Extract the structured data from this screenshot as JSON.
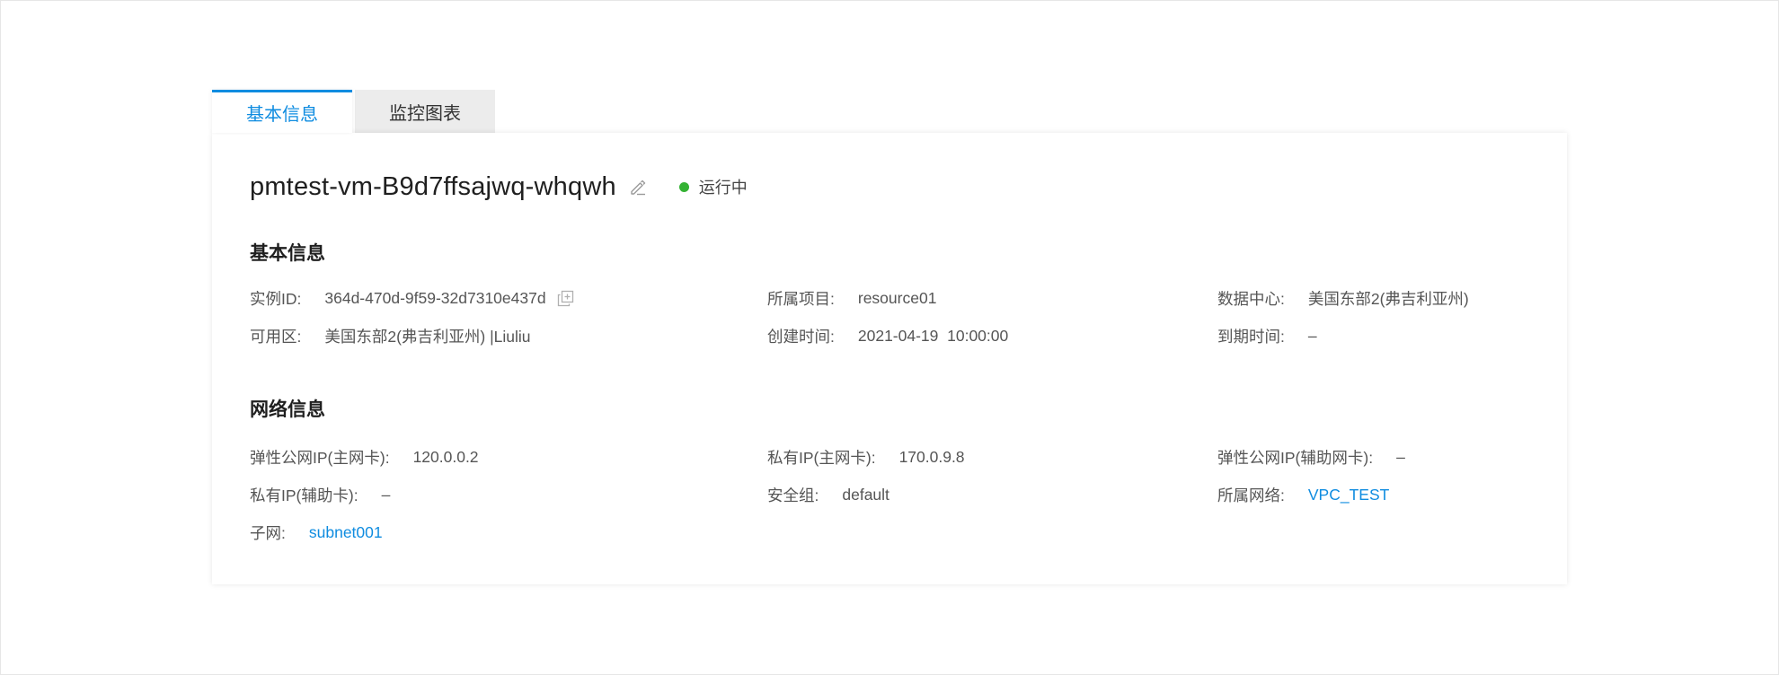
{
  "tabs": [
    {
      "label": "基本信息",
      "active": true
    },
    {
      "label": "监控图表",
      "active": false
    }
  ],
  "instance": {
    "name": "pmtest-vm-B9d7ffsajwq-whqwh",
    "status": "运行中",
    "status_color": "#34b233"
  },
  "basic": {
    "title": "基本信息",
    "instance_id_label": "实例ID:",
    "instance_id": "364d-470d-9f59-32d7310e437d",
    "project_label": "所属项目:",
    "project": "resource01",
    "datacenter_label": "数据中心:",
    "datacenter": "美国东部2(弗吉利亚州)",
    "zone_label": "可用区:",
    "zone": "美国东部2(弗吉利亚州) |Liuliu",
    "created_label": "创建时间:",
    "created": "2021-04-19  10:00:00",
    "expire_label": "到期时间:",
    "expire": "–"
  },
  "network": {
    "title": "网络信息",
    "eip_primary_label": "弹性公网IP(主网卡):",
    "eip_primary": "120.0.0.2",
    "private_ip_primary_label": "私有IP(主网卡):",
    "private_ip_primary": "170.0.9.8",
    "eip_secondary_label": "弹性公网IP(辅助网卡):",
    "eip_secondary": "–",
    "private_ip_secondary_label": "私有IP(辅助卡):",
    "private_ip_secondary": "–",
    "security_group_label": "安全组:",
    "security_group": "default",
    "vpc_label": "所属网络:",
    "vpc": "VPC_TEST",
    "subnet_label": "子网:",
    "subnet": "subnet001"
  },
  "colors": {
    "accent": "#0f8ce0",
    "running": "#34b233"
  }
}
